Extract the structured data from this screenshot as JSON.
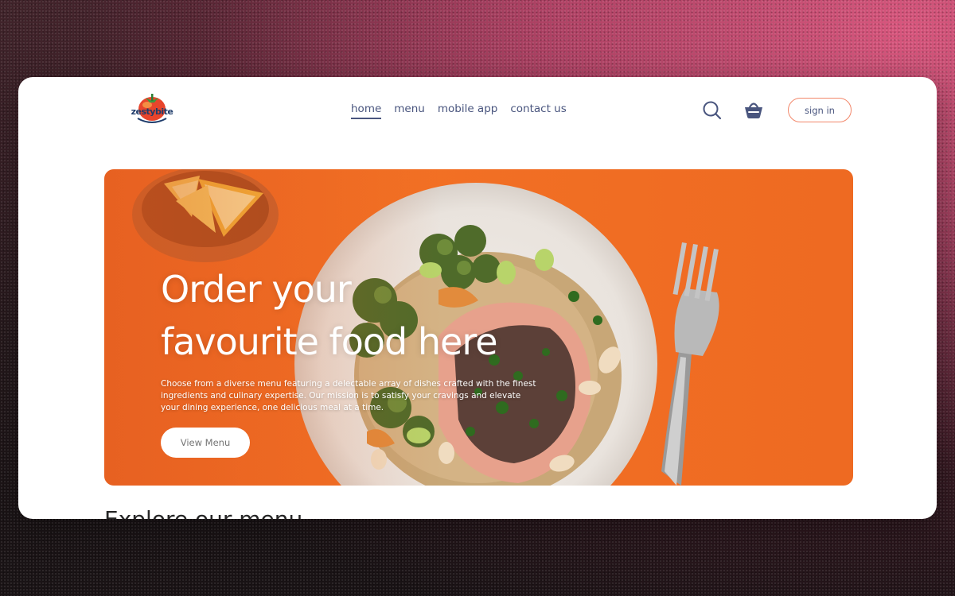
{
  "brand": {
    "logo_text": "zestybite",
    "logo_icon": "tomato-logo-icon"
  },
  "nav": {
    "items": [
      {
        "label": "home",
        "active": true
      },
      {
        "label": "menu",
        "active": false
      },
      {
        "label": "mobile app",
        "active": false
      },
      {
        "label": "contact us",
        "active": false
      }
    ]
  },
  "header": {
    "search_icon": "search-icon",
    "basket_icon": "basket-icon",
    "signin_label": "sign in"
  },
  "hero": {
    "title_line1": "Order your",
    "title_line2": "favourite food here",
    "description": "Choose from a diverse menu featuring a delectable array of dishes crafted with the finest ingredients and culinary expertise. Our mission is to satisfy your cravings and elevate your dining experience, one delicious meal at a time.",
    "button_label": "View Menu"
  },
  "explore": {
    "heading": "Explore our menu"
  },
  "colors": {
    "accent": "#f36a27",
    "nav_text": "#49557e",
    "signin_border": "#f2876a"
  }
}
